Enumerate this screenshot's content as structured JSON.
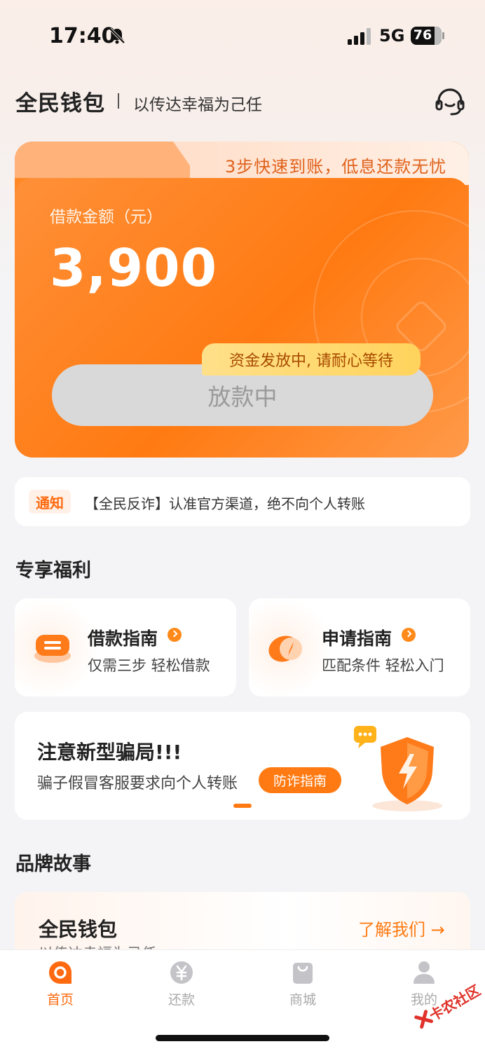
{
  "status_bar": {
    "time": "17:40",
    "network": "5G",
    "battery": "76"
  },
  "header": {
    "brand": "全民钱包",
    "slogan": "以传达幸福为己任",
    "service_icon": "customer-service-headset-icon"
  },
  "loan_card": {
    "tab_text": "3步快速到账，低息还款无忧",
    "amount_label": "借款金额（元）",
    "amount_value": "3,900",
    "button_label": "放款中",
    "tooltip": "资金发放中, 请耐心等待"
  },
  "notice": {
    "tag": "通知",
    "text": "【全民反诈】认准官方渠道，绝不向个人转账"
  },
  "benefits": {
    "title": "专享福利",
    "cards": [
      {
        "title": "借款指南",
        "subtitle": "仅需三步 轻松借款"
      },
      {
        "title": "申请指南",
        "subtitle": "匹配条件 轻松入门"
      }
    ]
  },
  "fraud_banner": {
    "title": "注意新型骗局!!!",
    "subtitle": "骗子假冒客服要求向个人转账",
    "button": "防诈指南"
  },
  "brand_story": {
    "title": "品牌故事",
    "card_title": "全民钱包",
    "card_subtitle": "以传达幸福为己任",
    "link": "了解我们 →"
  },
  "tab_bar": {
    "items": [
      {
        "label": "首页",
        "icon": "home-icon",
        "active": true
      },
      {
        "label": "还款",
        "icon": "yen-icon",
        "active": false
      },
      {
        "label": "商城",
        "icon": "shopping-bag-icon",
        "active": false
      },
      {
        "label": "我的",
        "icon": "user-icon",
        "active": false
      }
    ]
  },
  "watermark": "卡农社区",
  "colors": {
    "accent": "#ff7a12",
    "tooltip": "#ffd35c",
    "button_disabled": "#d9d9d9"
  }
}
